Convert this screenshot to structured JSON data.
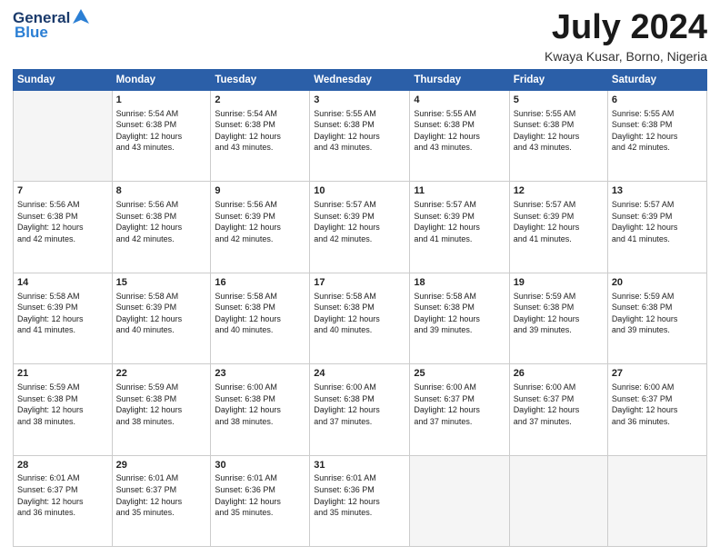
{
  "header": {
    "logo_general": "General",
    "logo_blue": "Blue",
    "month_year": "July 2024",
    "location": "Kwaya Kusar, Borno, Nigeria"
  },
  "weekdays": [
    "Sunday",
    "Monday",
    "Tuesday",
    "Wednesday",
    "Thursday",
    "Friday",
    "Saturday"
  ],
  "weeks": [
    [
      {
        "day": "",
        "info": ""
      },
      {
        "day": "1",
        "info": "Sunrise: 5:54 AM\nSunset: 6:38 PM\nDaylight: 12 hours\nand 43 minutes."
      },
      {
        "day": "2",
        "info": "Sunrise: 5:54 AM\nSunset: 6:38 PM\nDaylight: 12 hours\nand 43 minutes."
      },
      {
        "day": "3",
        "info": "Sunrise: 5:55 AM\nSunset: 6:38 PM\nDaylight: 12 hours\nand 43 minutes."
      },
      {
        "day": "4",
        "info": "Sunrise: 5:55 AM\nSunset: 6:38 PM\nDaylight: 12 hours\nand 43 minutes."
      },
      {
        "day": "5",
        "info": "Sunrise: 5:55 AM\nSunset: 6:38 PM\nDaylight: 12 hours\nand 43 minutes."
      },
      {
        "day": "6",
        "info": "Sunrise: 5:55 AM\nSunset: 6:38 PM\nDaylight: 12 hours\nand 42 minutes."
      }
    ],
    [
      {
        "day": "7",
        "info": "Sunrise: 5:56 AM\nSunset: 6:38 PM\nDaylight: 12 hours\nand 42 minutes."
      },
      {
        "day": "8",
        "info": "Sunrise: 5:56 AM\nSunset: 6:38 PM\nDaylight: 12 hours\nand 42 minutes."
      },
      {
        "day": "9",
        "info": "Sunrise: 5:56 AM\nSunset: 6:39 PM\nDaylight: 12 hours\nand 42 minutes."
      },
      {
        "day": "10",
        "info": "Sunrise: 5:57 AM\nSunset: 6:39 PM\nDaylight: 12 hours\nand 42 minutes."
      },
      {
        "day": "11",
        "info": "Sunrise: 5:57 AM\nSunset: 6:39 PM\nDaylight: 12 hours\nand 41 minutes."
      },
      {
        "day": "12",
        "info": "Sunrise: 5:57 AM\nSunset: 6:39 PM\nDaylight: 12 hours\nand 41 minutes."
      },
      {
        "day": "13",
        "info": "Sunrise: 5:57 AM\nSunset: 6:39 PM\nDaylight: 12 hours\nand 41 minutes."
      }
    ],
    [
      {
        "day": "14",
        "info": "Sunrise: 5:58 AM\nSunset: 6:39 PM\nDaylight: 12 hours\nand 41 minutes."
      },
      {
        "day": "15",
        "info": "Sunrise: 5:58 AM\nSunset: 6:39 PM\nDaylight: 12 hours\nand 40 minutes."
      },
      {
        "day": "16",
        "info": "Sunrise: 5:58 AM\nSunset: 6:38 PM\nDaylight: 12 hours\nand 40 minutes."
      },
      {
        "day": "17",
        "info": "Sunrise: 5:58 AM\nSunset: 6:38 PM\nDaylight: 12 hours\nand 40 minutes."
      },
      {
        "day": "18",
        "info": "Sunrise: 5:58 AM\nSunset: 6:38 PM\nDaylight: 12 hours\nand 39 minutes."
      },
      {
        "day": "19",
        "info": "Sunrise: 5:59 AM\nSunset: 6:38 PM\nDaylight: 12 hours\nand 39 minutes."
      },
      {
        "day": "20",
        "info": "Sunrise: 5:59 AM\nSunset: 6:38 PM\nDaylight: 12 hours\nand 39 minutes."
      }
    ],
    [
      {
        "day": "21",
        "info": "Sunrise: 5:59 AM\nSunset: 6:38 PM\nDaylight: 12 hours\nand 38 minutes."
      },
      {
        "day": "22",
        "info": "Sunrise: 5:59 AM\nSunset: 6:38 PM\nDaylight: 12 hours\nand 38 minutes."
      },
      {
        "day": "23",
        "info": "Sunrise: 6:00 AM\nSunset: 6:38 PM\nDaylight: 12 hours\nand 38 minutes."
      },
      {
        "day": "24",
        "info": "Sunrise: 6:00 AM\nSunset: 6:38 PM\nDaylight: 12 hours\nand 37 minutes."
      },
      {
        "day": "25",
        "info": "Sunrise: 6:00 AM\nSunset: 6:37 PM\nDaylight: 12 hours\nand 37 minutes."
      },
      {
        "day": "26",
        "info": "Sunrise: 6:00 AM\nSunset: 6:37 PM\nDaylight: 12 hours\nand 37 minutes."
      },
      {
        "day": "27",
        "info": "Sunrise: 6:00 AM\nSunset: 6:37 PM\nDaylight: 12 hours\nand 36 minutes."
      }
    ],
    [
      {
        "day": "28",
        "info": "Sunrise: 6:01 AM\nSunset: 6:37 PM\nDaylight: 12 hours\nand 36 minutes."
      },
      {
        "day": "29",
        "info": "Sunrise: 6:01 AM\nSunset: 6:37 PM\nDaylight: 12 hours\nand 35 minutes."
      },
      {
        "day": "30",
        "info": "Sunrise: 6:01 AM\nSunset: 6:36 PM\nDaylight: 12 hours\nand 35 minutes."
      },
      {
        "day": "31",
        "info": "Sunrise: 6:01 AM\nSunset: 6:36 PM\nDaylight: 12 hours\nand 35 minutes."
      },
      {
        "day": "",
        "info": ""
      },
      {
        "day": "",
        "info": ""
      },
      {
        "day": "",
        "info": ""
      }
    ]
  ]
}
